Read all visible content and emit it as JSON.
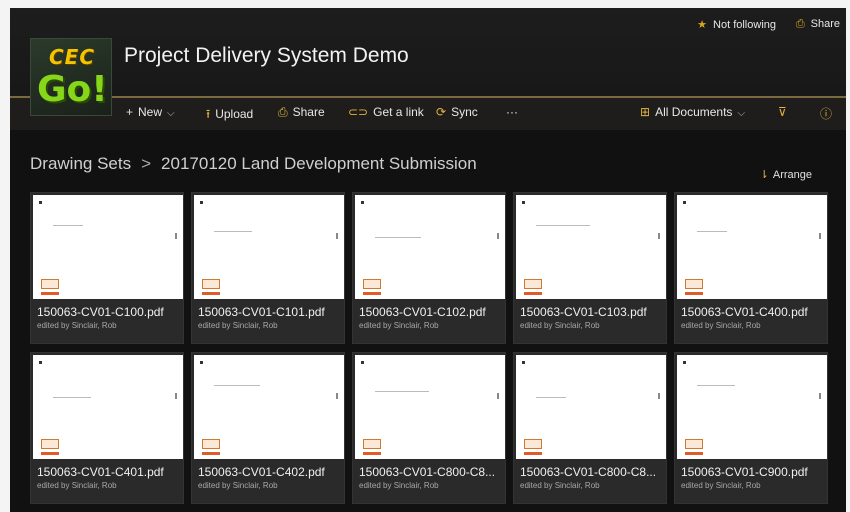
{
  "header": {
    "site_title": "Project Delivery System Demo",
    "follow_label": "Not following",
    "share_label": "Share",
    "logo": {
      "line1": "CEC",
      "line2": "Go!",
      "accent_colors": [
        "#f5c400",
        "#86d61a"
      ]
    }
  },
  "toolbar": {
    "new_label": "New",
    "upload_label": "Upload",
    "share_label": "Share",
    "get_link_label": "Get a link",
    "sync_label": "Sync",
    "more_label": "···",
    "view_label": "All Documents",
    "icons": [
      "plus-icon",
      "upload-icon",
      "share-icon",
      "link-icon",
      "sync-icon",
      "grid-view-icon",
      "filter-icon",
      "info-icon"
    ]
  },
  "breadcrumb": {
    "parent": "Drawing Sets",
    "current": "20170120 Land Development Submission"
  },
  "arrange_label": "Arrange",
  "files": [
    {
      "name": "150063-CV01-C100.pdf",
      "edited": "edited by Sinclair, Rob"
    },
    {
      "name": "150063-CV01-C101.pdf",
      "edited": "edited by Sinclair, Rob"
    },
    {
      "name": "150063-CV01-C102.pdf",
      "edited": "edited by Sinclair, Rob"
    },
    {
      "name": "150063-CV01-C103.pdf",
      "edited": "edited by Sinclair, Rob"
    },
    {
      "name": "150063-CV01-C400.pdf",
      "edited": "edited by Sinclair, Rob"
    },
    {
      "name": "150063-CV01-C401.pdf",
      "edited": "edited by Sinclair, Rob"
    },
    {
      "name": "150063-CV01-C402.pdf",
      "edited": "edited by Sinclair, Rob"
    },
    {
      "name": "150063-CV01-C800-C8...",
      "edited": "edited by Sinclair, Rob"
    },
    {
      "name": "150063-CV01-C800-C8...",
      "edited": "edited by Sinclair, Rob"
    },
    {
      "name": "150063-CV01-C900.pdf",
      "edited": "edited by Sinclair, Rob"
    }
  ],
  "colors": {
    "accent": "#e2b441",
    "background": "#111111"
  }
}
